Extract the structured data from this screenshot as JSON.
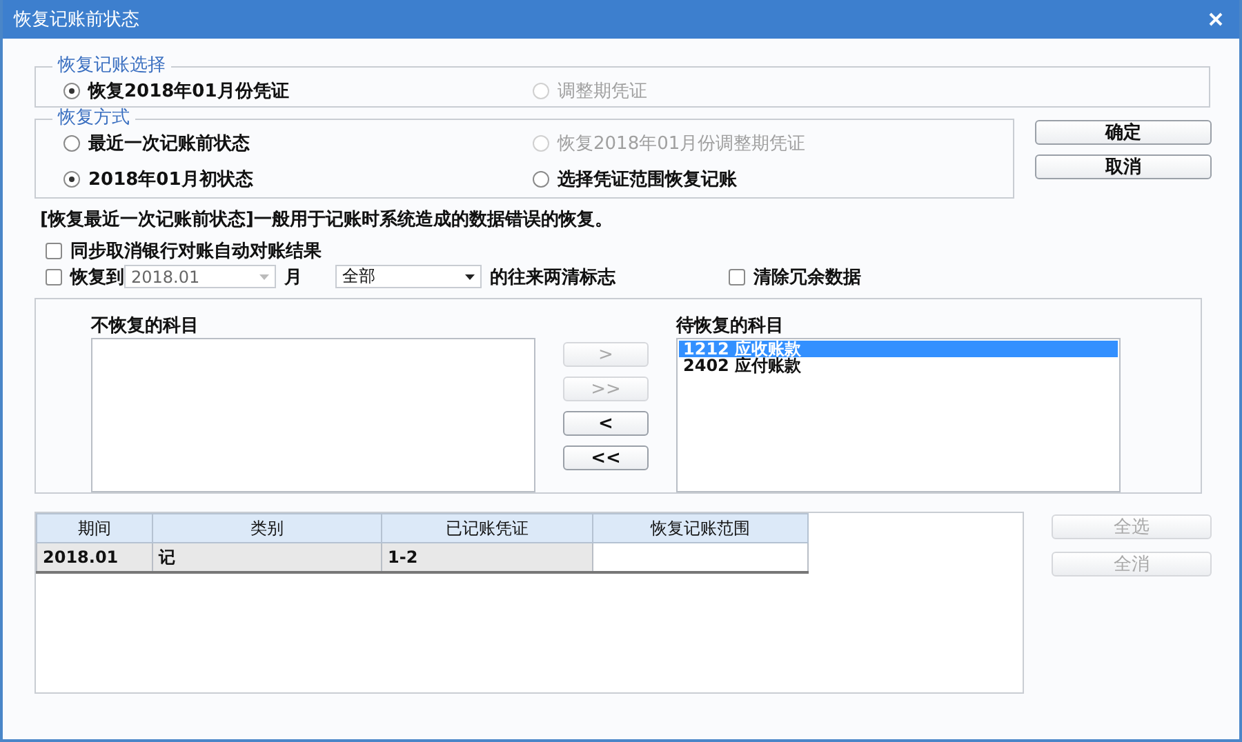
{
  "window": {
    "title": "恢复记账前状态"
  },
  "voucher_group": {
    "legend": "恢复记账选择",
    "options": [
      {
        "label": "恢复2018年01月份凭证",
        "selected": true,
        "disabled": false
      },
      {
        "label": "调整期凭证",
        "selected": false,
        "disabled": true
      }
    ]
  },
  "mode_group": {
    "legend": "恢复方式",
    "options": [
      {
        "label": "最近一次记账前状态",
        "selected": false,
        "disabled": false
      },
      {
        "label": "恢复2018年01月份调整期凭证",
        "selected": false,
        "disabled": true
      },
      {
        "label": "2018年01月初状态",
        "selected": true,
        "disabled": false
      },
      {
        "label": "选择凭证范围恢复记账",
        "selected": false,
        "disabled": false
      }
    ]
  },
  "buttons": [
    {
      "label": "确定"
    },
    {
      "label": "取消"
    }
  ],
  "note": "[恢复最近一次记账前状态]一般用于记账时系统造成的数据错误的恢复。",
  "sync_bank": {
    "label": "同步取消银行对账自动对账结果",
    "checked": false
  },
  "restore_to": {
    "label": "恢复到",
    "checked": false,
    "month_value": "2018.01",
    "month_disabled": true,
    "month_label": "月",
    "type_value": "全部",
    "suffix": "的往来两清标志"
  },
  "clear_redundant": {
    "label": "清除冗余数据",
    "checked": false
  },
  "unrestored": {
    "label": "不恢复的科目"
  },
  "move_buttons": [
    {
      "label": ">",
      "disabled": true
    },
    {
      "label": ">>",
      "disabled": true
    },
    {
      "label": "<",
      "disabled": false
    },
    {
      "label": "<<",
      "disabled": false
    }
  ],
  "pending": {
    "label": "待恢复的科目",
    "items": [
      {
        "text": "1212 应收账款",
        "selected": true
      },
      {
        "text": "2402 应付账款",
        "selected": false
      }
    ]
  },
  "table": {
    "columns": [
      "期间",
      "类别",
      "已记账凭证",
      "恢复记账范围"
    ],
    "rows": [
      {
        "cells": [
          "2018.01",
          "记",
          "1-2"
        ]
      }
    ]
  },
  "side_buttons": [
    {
      "label": "全选",
      "disabled": true
    },
    {
      "label": "全消",
      "disabled": true
    }
  ]
}
